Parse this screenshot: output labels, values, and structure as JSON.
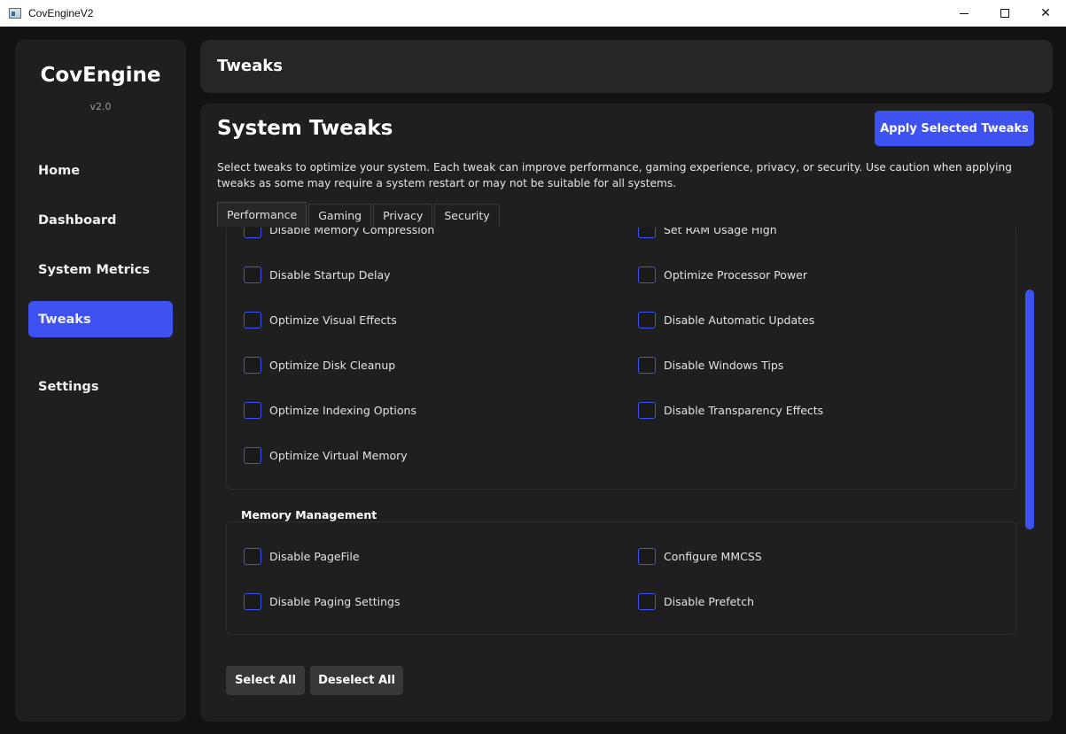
{
  "window": {
    "title": "CovEngineV2",
    "min_icon": "minimize-icon",
    "max_icon": "maximize-icon",
    "close_glyph": "✕"
  },
  "sidebar": {
    "brand": "CovEngine",
    "version": "v2.0",
    "items": [
      {
        "label": "Home"
      },
      {
        "label": "Dashboard"
      },
      {
        "label": "System Metrics"
      },
      {
        "label": "Tweaks",
        "active": true
      },
      {
        "label": "Settings"
      }
    ]
  },
  "header": {
    "title": "Tweaks"
  },
  "main": {
    "title": "System Tweaks",
    "apply_label": "Apply Selected Tweaks",
    "description": "Select tweaks to optimize your system. Each tweak can improve performance, gaming experience, privacy, or security. Use caution when applying tweaks as some may require a system restart or may not be suitable for all systems.",
    "tabs": [
      "Performance",
      "Gaming",
      "Privacy",
      "Security"
    ],
    "active_tab": "Performance",
    "groups": [
      {
        "title": "",
        "left": [
          "Disable Memory Compression",
          "Disable Startup Delay",
          "Optimize Visual Effects",
          "Optimize Disk Cleanup",
          "Optimize Indexing Options",
          "Optimize Virtual Memory"
        ],
        "right": [
          "Set RAM Usage High",
          "Optimize Processor Power",
          "Disable Automatic Updates",
          "Disable Windows Tips",
          "Disable Transparency Effects"
        ]
      },
      {
        "title": "Memory Management",
        "left": [
          "Disable PageFile",
          "Disable Paging Settings"
        ],
        "right": [
          "Configure MMCSS",
          "Disable Prefetch"
        ]
      }
    ],
    "select_all_label": "Select All",
    "deselect_all_label": "Deselect All"
  },
  "colors": {
    "accent": "#3d52f0",
    "panel": "#1f1f1f",
    "background": "#121212"
  }
}
